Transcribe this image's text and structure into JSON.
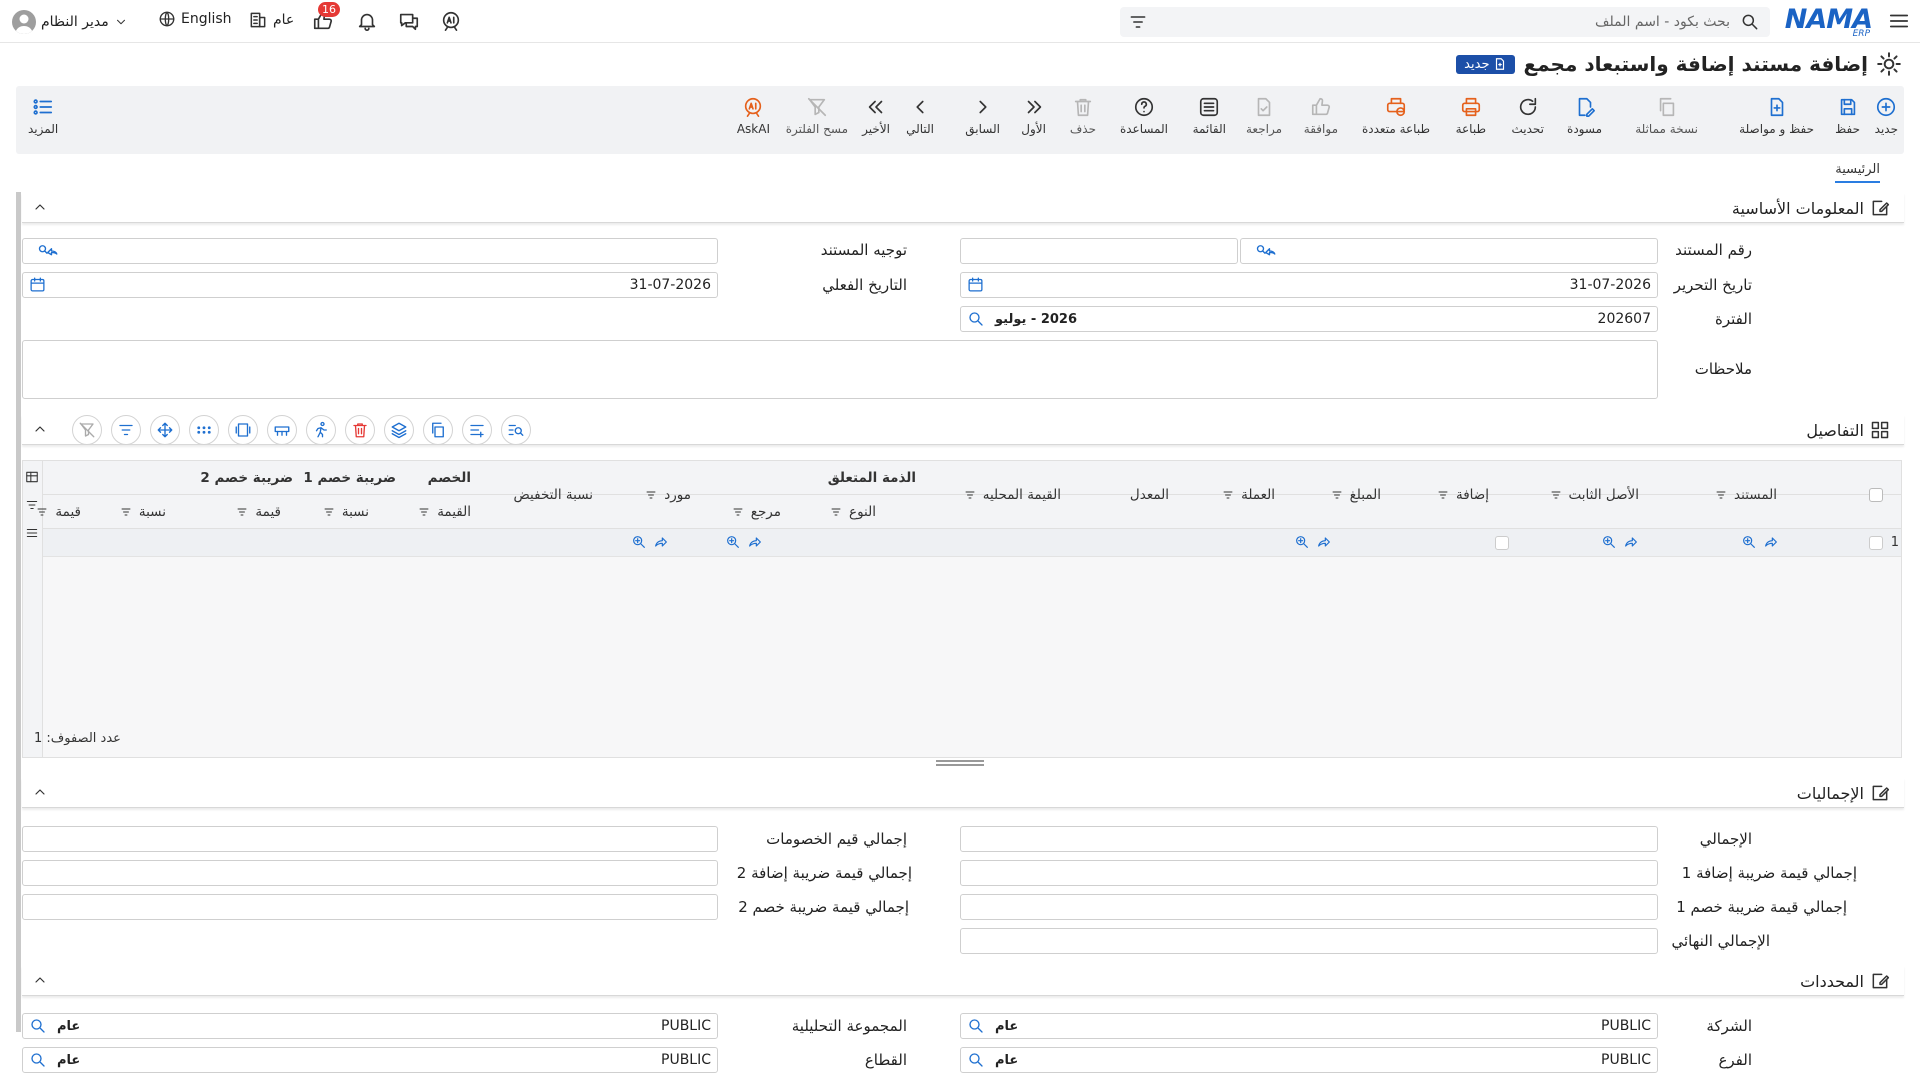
{
  "topbar": {
    "search_placeholder": "بحث بكود - اسم الملف",
    "user_name": "مدير النظام",
    "language": "English",
    "scope": "عام",
    "notifications_count": "16"
  },
  "brand": {
    "name": "NAMA",
    "sub": "ERP"
  },
  "page": {
    "title": "إضافة مستند إضافة واستبعاد مجمع",
    "status_badge": "جديد"
  },
  "toolbar": {
    "new": "جديد",
    "save": "حفظ",
    "save_continue": "حفظ و مواصلة",
    "duplicate": "نسخة مماثلة",
    "draft": "مسودة",
    "refresh": "تحديث",
    "print": "طباعة",
    "multi_print": "طباعة متعددة",
    "approve": "موافقة",
    "review": "مراجعة",
    "list": "القائمة",
    "help": "المساعدة",
    "delete": "حذف",
    "first": "الأول",
    "prev": "السابق",
    "next": "التالي",
    "last": "الأخير",
    "clear_filter": "مسح الفلترة",
    "askai": "AskAI",
    "more": "المزيد"
  },
  "tabs": {
    "home": "الرئيسية"
  },
  "sections": {
    "basic": "المعلومات الأساسية",
    "details": "التفاصيل",
    "totals": "الإجماليات",
    "dims": "المحددات"
  },
  "basic": {
    "doc_number_label": "رقم المستند",
    "doc_direction_label": "توجيه المستند",
    "edit_date_label": "تاريخ التحرير",
    "edit_date_value": "31-07-2026",
    "actual_date_label": "التاريخ الفعلي",
    "actual_date_value": "31-07-2026",
    "period_label": "الفترة",
    "period_code": "202607",
    "period_name": "2026 - يوليو",
    "notes_label": "ملاحظات"
  },
  "grid": {
    "cols": {
      "doc": "المستند",
      "asset": "الأصل الثابت",
      "add": "إضافة",
      "amount": "المبلغ",
      "currency": "العملة",
      "rate": "المعدل",
      "local_value": "القيمة المحليه",
      "liability": "الذمة المتعلق",
      "type": "النوع",
      "ref": "مرجع",
      "supplier": "مورد",
      "disc_pct": "نسبة التخفيض",
      "discount": "الخصم",
      "value": "القيمة",
      "tax1": "ضريبة خصم 1",
      "tax2": "ضريبة خصم 2",
      "pct": "نسبة",
      "val": "قيمة"
    },
    "row_number": "1",
    "rows_count_label": "عدد الصفوف: 1"
  },
  "totals": {
    "total": "الإجمالي",
    "discounts_total": "إجمالي قيم الخصومات",
    "add_tax1": "إجمالي قيمة ضريبة إضافة 1",
    "add_tax2": "إجمالي قيمة ضريبة إضافة 2",
    "disc_tax1": "إجمالي قيمة ضريبة خصم 1",
    "disc_tax2": "إجمالي قيمة ضريبة خصم 2",
    "final": "الإجمالي النهائي"
  },
  "dims": {
    "company_label": "الشركة",
    "company_code": "PUBLIC",
    "company_name": "عام",
    "group_label": "المجموعة التحليلية",
    "group_code": "PUBLIC",
    "group_name": "عام",
    "branch_label": "الفرع",
    "branch_code": "PUBLIC",
    "branch_name": "عام",
    "sector_label": "القطاع",
    "sector_code": "PUBLIC",
    "sector_name": "عام"
  }
}
